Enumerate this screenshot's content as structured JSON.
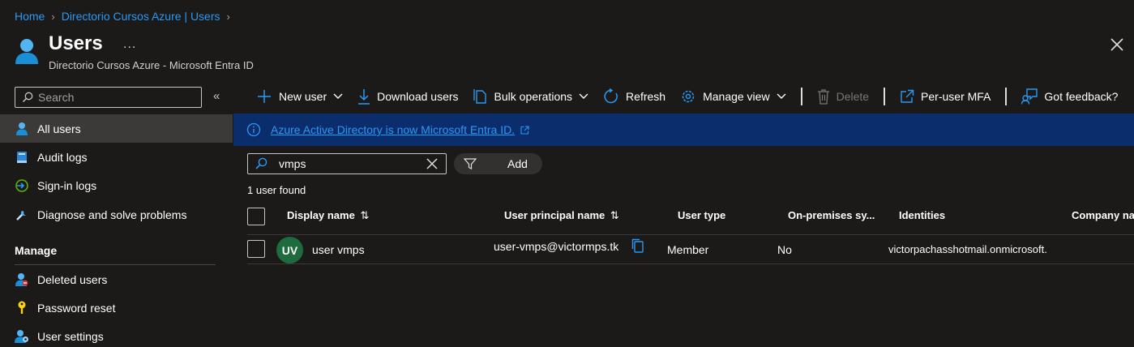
{
  "breadcrumb": [
    {
      "label": "Home"
    },
    {
      "label": "Directorio Cursos Azure | Users"
    }
  ],
  "header": {
    "title": "Users",
    "more": "...",
    "subtitle": "Directorio Cursos Azure - Microsoft Entra ID"
  },
  "sidebar": {
    "search_placeholder": "Search",
    "collapse": "«",
    "items": [
      {
        "label": "All users",
        "icon": "user-icon"
      },
      {
        "label": "Audit logs",
        "icon": "book-icon"
      },
      {
        "label": "Sign-in logs",
        "icon": "sign-in-icon"
      },
      {
        "label": "Diagnose and solve problems",
        "icon": "wrench-icon"
      }
    ],
    "manage_label": "Manage",
    "manage_items": [
      {
        "label": "Deleted users",
        "icon": "deleted-user-icon"
      },
      {
        "label": "Password reset",
        "icon": "key-icon"
      },
      {
        "label": "User settings",
        "icon": "user-settings-icon"
      }
    ]
  },
  "toolbar": {
    "new_user": "New user",
    "download_users": "Download users",
    "bulk_operations": "Bulk operations",
    "refresh": "Refresh",
    "manage_view": "Manage view",
    "delete": "Delete",
    "per_user_mfa": "Per-user MFA",
    "got_feedback": "Got feedback?"
  },
  "banner": {
    "text": "Azure Active Directory is now Microsoft Entra ID."
  },
  "filter": {
    "search_value": "vmps",
    "add_label": "Add",
    "result_count": "1 user found"
  },
  "table": {
    "columns": [
      "Display name",
      "User principal name",
      "User type",
      "On-premises sy...",
      "Identities",
      "Company na"
    ],
    "rows": [
      {
        "initials": "UV",
        "display_name": "user vmps",
        "upn": "user-vmps@victormps.tk",
        "user_type": "Member",
        "on_prem": "No",
        "identities": "victorpachasshotmail.onmicrosoft."
      }
    ]
  },
  "colors": {
    "background": "#1b1a19",
    "accent": "#2899f5",
    "banner": "#0c2d6b",
    "avatar": "#1e6b3e"
  }
}
